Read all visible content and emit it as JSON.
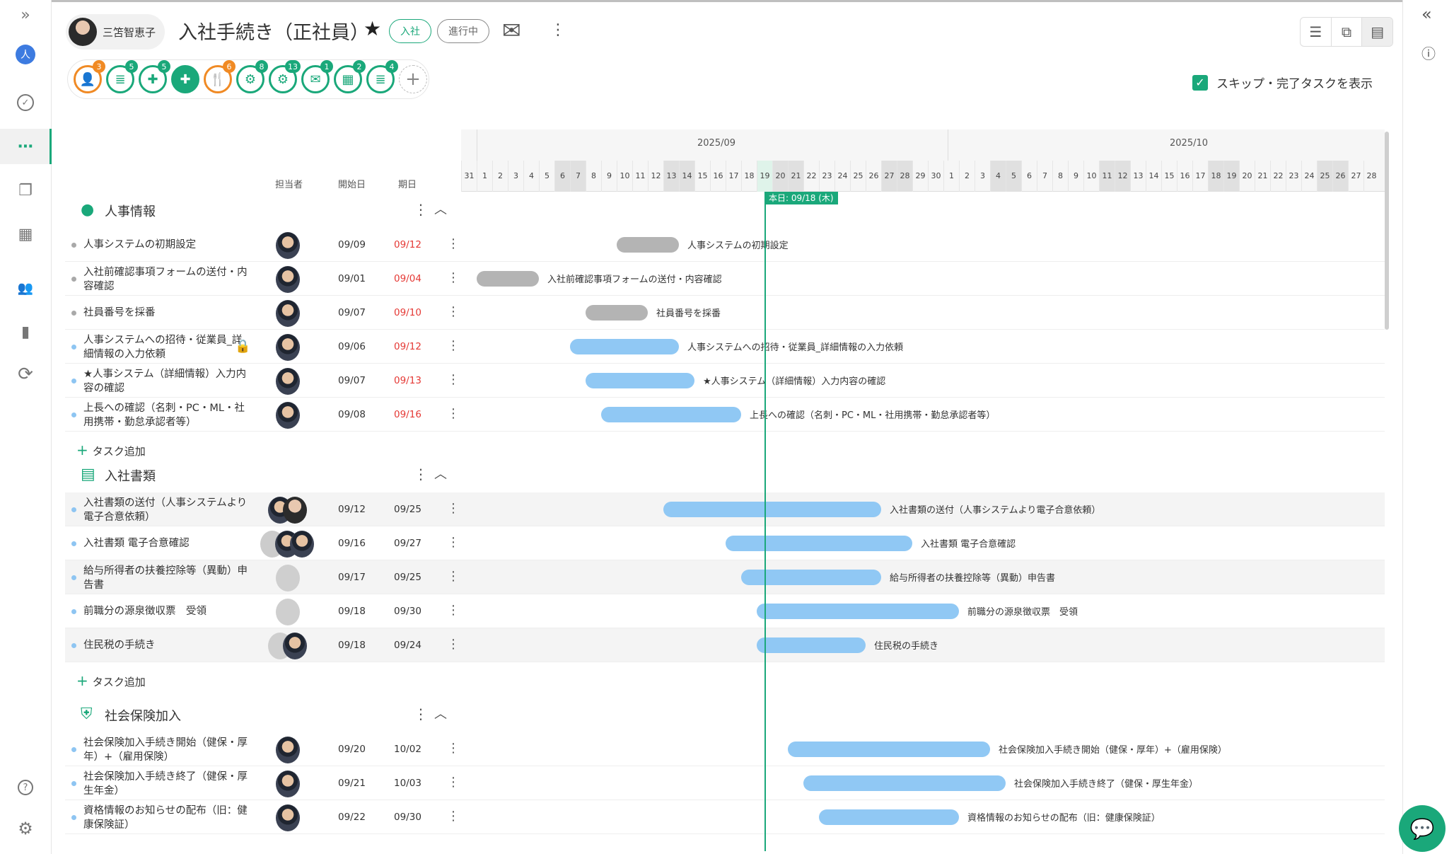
{
  "sidebar": {
    "items": [
      {
        "name": "expand",
        "icon": "double-chevron-right-icon",
        "glyph": "»"
      },
      {
        "name": "company",
        "icon": "company-avatar-icon",
        "glyph": "人"
      },
      {
        "name": "tasks",
        "icon": "check-circle-icon",
        "glyph": "✓"
      },
      {
        "name": "workflow",
        "icon": "workflow-icon",
        "glyph": "⋯"
      },
      {
        "name": "documents",
        "icon": "documents-icon",
        "glyph": "❐"
      },
      {
        "name": "table",
        "icon": "table-icon",
        "glyph": "▦"
      },
      {
        "name": "members",
        "icon": "people-icon",
        "glyph": "👥"
      },
      {
        "name": "analytics",
        "icon": "bar-chart-icon",
        "glyph": "▮"
      },
      {
        "name": "sync",
        "icon": "sync-icon",
        "glyph": "⟳"
      },
      {
        "name": "help",
        "icon": "help-icon",
        "glyph": "?"
      },
      {
        "name": "settings",
        "icon": "gear-icon",
        "glyph": "⚙"
      }
    ]
  },
  "rightbar": {
    "collapse_glyph": "«",
    "info_glyph": "ⓘ"
  },
  "header": {
    "assignee_name": "三笘智恵子",
    "title": "入社手続き（正社員）",
    "star": "★",
    "tag_type": "入社",
    "tag_status": "進行中",
    "mail_glyph": "✉",
    "more_glyph": "⋮"
  },
  "categories": [
    {
      "glyph": "👤",
      "count": "3",
      "style": "o"
    },
    {
      "glyph": "≣",
      "count": "5",
      "style": "g"
    },
    {
      "glyph": "✚",
      "count": "5",
      "style": "g"
    },
    {
      "glyph": "✚",
      "count": "",
      "style": "gf"
    },
    {
      "glyph": "🍴",
      "count": "6",
      "style": "o"
    },
    {
      "glyph": "⚙",
      "count": "8",
      "style": "g"
    },
    {
      "glyph": "⚙",
      "count": "13",
      "style": "g"
    },
    {
      "glyph": "✉",
      "count": "1",
      "style": "g"
    },
    {
      "glyph": "▦",
      "count": "2",
      "style": "g"
    },
    {
      "glyph": "≣",
      "count": "4",
      "style": "g"
    },
    {
      "glyph": "+",
      "count": "",
      "style": "add"
    }
  ],
  "skip_label": "スキップ・完了タスクを表示",
  "columns": {
    "assignee": "担当者",
    "start": "開始日",
    "due": "期日"
  },
  "add_task_label": "タスク追加",
  "gantt": {
    "month1": "2025/09",
    "month2": "2025/10",
    "today_label": "本日: 09/18 (木)",
    "days": [
      "31",
      "1",
      "2",
      "3",
      "4",
      "5",
      "6",
      "7",
      "8",
      "9",
      "10",
      "11",
      "12",
      "13",
      "14",
      "15",
      "16",
      "17",
      "18",
      "19",
      "20",
      "21",
      "22",
      "23",
      "24",
      "25",
      "26",
      "27",
      "28",
      "29",
      "30",
      "1",
      "2",
      "3",
      "4",
      "5",
      "6",
      "7",
      "8",
      "9",
      "10",
      "11",
      "12",
      "13",
      "14",
      "15",
      "16",
      "17",
      "18",
      "19",
      "20",
      "21",
      "22",
      "23",
      "24",
      "25",
      "26",
      "27",
      "28"
    ]
  },
  "sections": [
    {
      "title": "人事情報",
      "icon": "person-icon",
      "tasks": [
        {
          "name": "人事システムの初期設定",
          "start": "09/09",
          "due": "09/12",
          "due_red": true,
          "status": "gr",
          "bar_start": 10,
          "bar_end": 14,
          "label": "人事システムの初期設定"
        },
        {
          "name": "入社前確認事項フォームの送付・内容確認",
          "start": "09/01",
          "due": "09/04",
          "due_red": true,
          "status": "gr",
          "bar_start": 1,
          "bar_end": 5,
          "label": "入社前確認事項フォームの送付・内容確認"
        },
        {
          "name": "社員番号を採番",
          "start": "09/07",
          "due": "09/10",
          "due_red": true,
          "status": "gr",
          "bar_start": 8,
          "bar_end": 12,
          "label": "社員番号を採番"
        },
        {
          "name": "人事システムへの招待・従業員_詳細情報の入力依頼",
          "start": "09/06",
          "due": "09/12",
          "due_red": true,
          "status": "bl",
          "lock": true,
          "bar_start": 7,
          "bar_end": 14,
          "label": "人事システムへの招待・従業員_詳細情報の入力依頼"
        },
        {
          "name": "★人事システム（詳細情報）入力内容の確認",
          "start": "09/07",
          "due": "09/13",
          "due_red": true,
          "status": "bl",
          "bar_start": 8,
          "bar_end": 15,
          "label": "★人事システム（詳細情報）入力内容の確認"
        },
        {
          "name": "上長への確認（名刺・PC・ML・社用携帯・勤怠承認者等）",
          "start": "09/08",
          "due": "09/16",
          "due_red": true,
          "status": "bl",
          "bar_start": 9,
          "bar_end": 18,
          "label": "上長への確認（名刺・PC・ML・社用携帯・勤怠承認者等）"
        }
      ]
    },
    {
      "title": "入社書類",
      "icon": "clipboard-icon",
      "tasks": [
        {
          "name": "入社書類の送付（人事システムより電子合意依頼）",
          "start": "09/12",
          "due": "09/25",
          "due_red": false,
          "status": "bl",
          "bar_start": 13,
          "bar_end": 27,
          "label": "入社書類の送付（人事システムより電子合意依頼）"
        },
        {
          "name": "入社書類 電子合意確認",
          "start": "09/16",
          "due": "09/27",
          "due_red": false,
          "status": "bl",
          "bar_start": 17,
          "bar_end": 29,
          "label": "入社書類 電子合意確認"
        },
        {
          "name": "給与所得者の扶養控除等（異動）申告書",
          "start": "09/17",
          "due": "09/25",
          "due_red": false,
          "status": "bl",
          "bar_start": 18,
          "bar_end": 27,
          "label": "給与所得者の扶養控除等（異動）申告書"
        },
        {
          "name": "前職分の源泉徴収票　受領",
          "start": "09/18",
          "due": "09/30",
          "due_red": false,
          "status": "bl",
          "bar_start": 19,
          "bar_end": 32,
          "label": "前職分の源泉徴収票　受領"
        },
        {
          "name": "住民税の手続き",
          "start": "09/18",
          "due": "09/24",
          "due_red": false,
          "status": "bl",
          "bar_start": 19,
          "bar_end": 26,
          "label": "住民税の手続き"
        }
      ]
    },
    {
      "title": "社会保険加入",
      "icon": "shield-icon",
      "tasks": [
        {
          "name": "社会保険加入手続き開始（健保・厚年）+（雇用保険）",
          "start": "09/20",
          "due": "10/02",
          "due_red": false,
          "status": "bl",
          "bar_start": 21,
          "bar_end": 34,
          "label": "社会保険加入手続き開始（健保・厚年）+（雇用保険）"
        },
        {
          "name": "社会保険加入手続き終了（健保・厚生年金）",
          "start": "09/21",
          "due": "10/03",
          "due_red": false,
          "status": "bl",
          "bar_start": 22,
          "bar_end": 35,
          "label": "社会保険加入手続き終了（健保・厚生年金）"
        },
        {
          "name": "資格情報のお知らせの配布（旧：健康保険証）",
          "start": "09/22",
          "due": "09/30",
          "due_red": false,
          "status": "bl",
          "bar_start": 23,
          "bar_end": 32,
          "label": "資格情報のお知らせの配布（旧：健康保険証）"
        }
      ]
    }
  ],
  "fab_glyph": "💬"
}
